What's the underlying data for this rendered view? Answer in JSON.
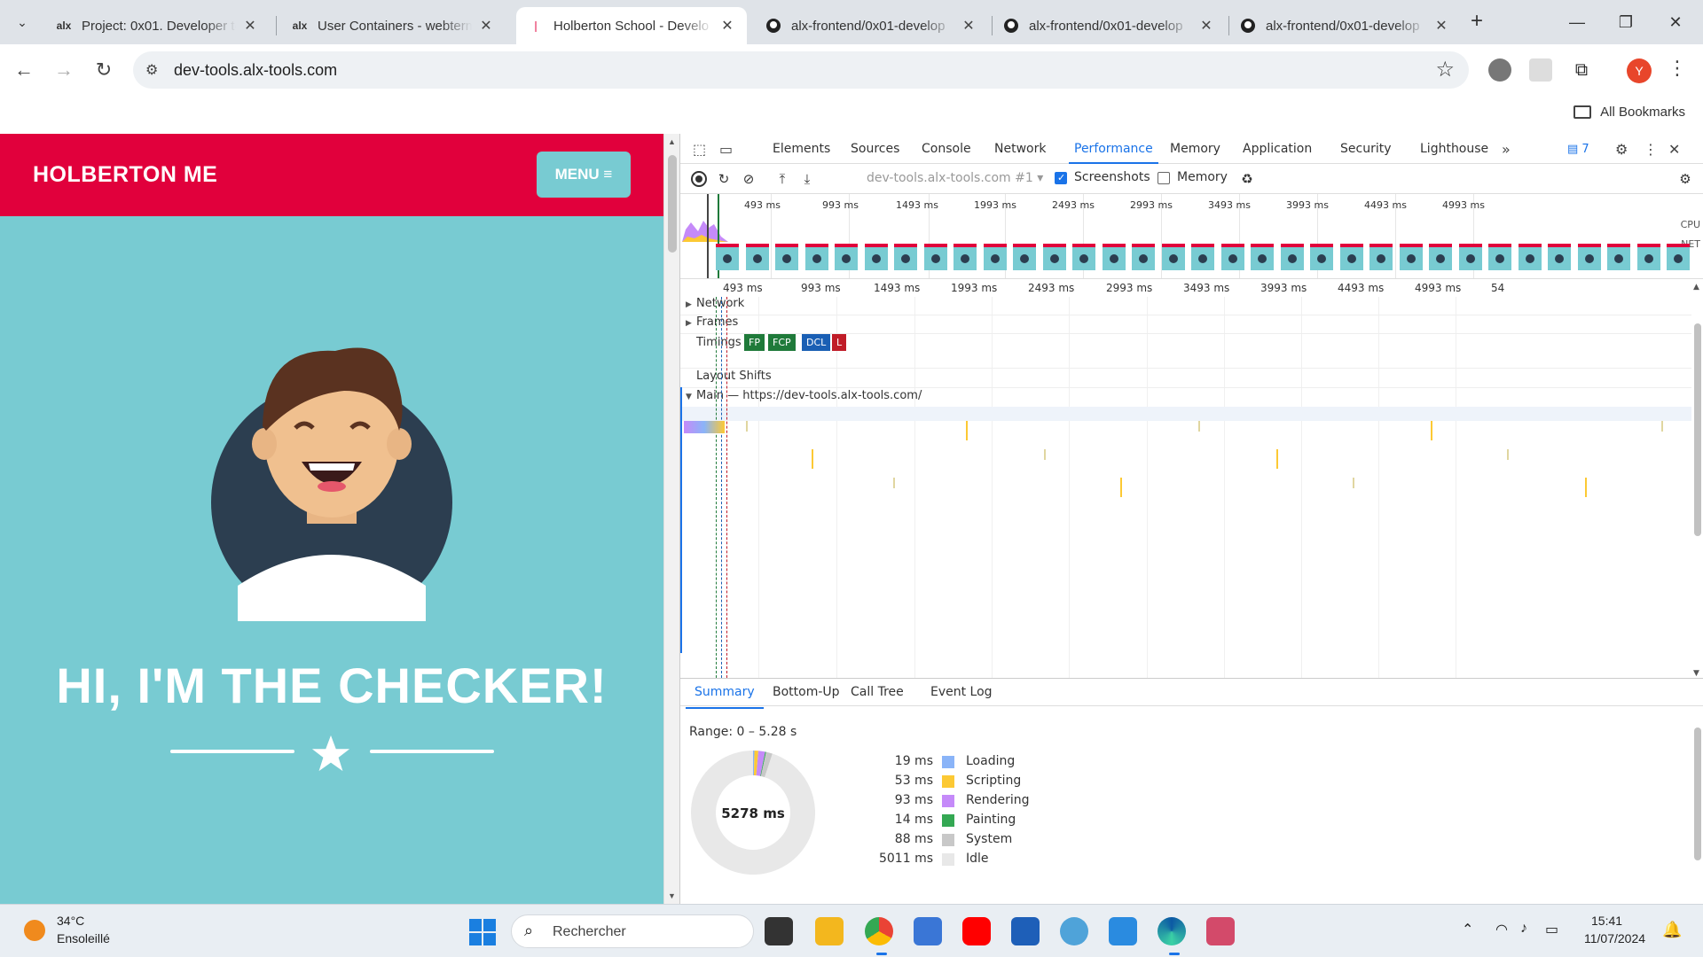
{
  "browser": {
    "tabs": [
      {
        "title": "Project: 0x01. Developer to",
        "favicon": "alx"
      },
      {
        "title": "User Containers - webterm",
        "favicon": "alx"
      },
      {
        "title": "Holberton School - Develo",
        "favicon": "holberton",
        "active": true
      },
      {
        "title": "alx-frontend/0x01-develop",
        "favicon": "github"
      },
      {
        "title": "alx-frontend/0x01-develop",
        "favicon": "github"
      },
      {
        "title": "alx-frontend/0x01-develop",
        "favicon": "github"
      }
    ],
    "url": "dev-tools.alx-tools.com",
    "profile_initial": "Y",
    "all_bookmarks": "All Bookmarks"
  },
  "page": {
    "brand": "HOLBERTON ME",
    "menu": "MENU ≡",
    "heading": "HI, I'M THE CHECKER!",
    "colors": {
      "header": "#e1003c",
      "background": "#78cbd2"
    }
  },
  "devtools": {
    "tabs": [
      "Elements",
      "Sources",
      "Console",
      "Network",
      "Performance",
      "Memory",
      "Application",
      "Security",
      "Lighthouse"
    ],
    "active_tab": "Performance",
    "issues_count": "7",
    "profile_select": "dev-tools.alx-tools.com #1",
    "screenshots_label": "Screenshots",
    "memory_label": "Memory",
    "overview_ticks": [
      "493 ms",
      "993 ms",
      "1493 ms",
      "1993 ms",
      "2493 ms",
      "2993 ms",
      "3493 ms",
      "3993 ms",
      "4493 ms",
      "4993 ms"
    ],
    "overview_labels": {
      "cpu": "CPU",
      "net": "NET"
    },
    "ruler_ticks": [
      "493 ms",
      "993 ms",
      "1493 ms",
      "1993 ms",
      "2493 ms",
      "2993 ms",
      "3493 ms",
      "3993 ms",
      "4493 ms",
      "4993 ms",
      "54"
    ],
    "tracks": {
      "network": "Network",
      "frames": "Frames",
      "timings": "Timings",
      "layout_shifts": "Layout Shifts",
      "main": "Main — https://dev-tools.alx-tools.com/"
    },
    "timing_markers": [
      {
        "label": "FP",
        "color": "#1f7a3a"
      },
      {
        "label": "FCP",
        "color": "#1f7a3a"
      },
      {
        "label": "DCL",
        "color": "#1a5fb4"
      },
      {
        "label": "L",
        "color": "#c01c28"
      }
    ],
    "summary_tabs": [
      "Summary",
      "Bottom-Up",
      "Call Tree",
      "Event Log"
    ],
    "range": "Range: 0 – 5.28 s",
    "total": "5278 ms",
    "breakdown": [
      {
        "value": "19 ms",
        "name": "Loading",
        "ms": 19,
        "color": "#8ab4f8"
      },
      {
        "value": "53 ms",
        "name": "Scripting",
        "ms": 53,
        "color": "#fcc934"
      },
      {
        "value": "93 ms",
        "name": "Rendering",
        "ms": 93,
        "color": "#c58af9"
      },
      {
        "value": "14 ms",
        "name": "Painting",
        "ms": 14,
        "color": "#34a853"
      },
      {
        "value": "88 ms",
        "name": "System",
        "ms": 88,
        "color": "#c8c8c8"
      },
      {
        "value": "5011 ms",
        "name": "Idle",
        "ms": 5011,
        "color": "#e8e8e8"
      }
    ]
  },
  "taskbar": {
    "temperature": "34°C",
    "weather": "Ensoleillé",
    "search": "Rechercher",
    "time": "15:41",
    "date": "11/07/2024"
  }
}
